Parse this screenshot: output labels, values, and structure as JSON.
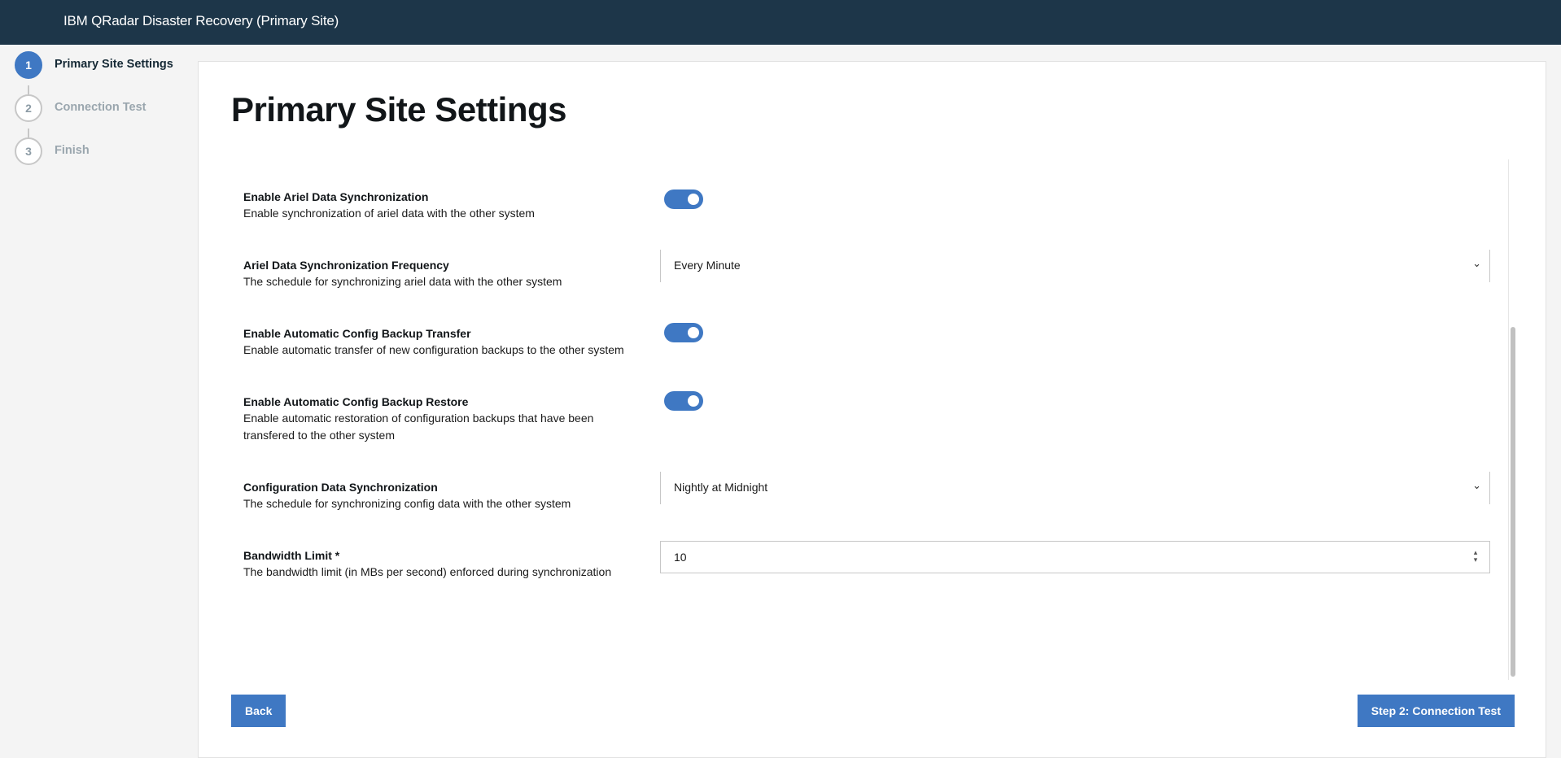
{
  "app": {
    "title": "IBM QRadar Disaster Recovery (Primary Site)"
  },
  "stepper": {
    "steps": [
      {
        "number": "1",
        "label": "Primary Site Settings",
        "active": true
      },
      {
        "number": "2",
        "label": "Connection Test",
        "active": false
      },
      {
        "number": "3",
        "label": "Finish",
        "active": false
      }
    ]
  },
  "page": {
    "title": "Primary Site Settings"
  },
  "settings": [
    {
      "label": "Enable Ariel Data Synchronization",
      "description": "Enable synchronization of ariel data with the other system",
      "control": "toggle",
      "value": "on"
    },
    {
      "label": "Ariel Data Synchronization Frequency",
      "description": "The schedule for synchronizing ariel data with the other system",
      "control": "select",
      "value": "Every Minute"
    },
    {
      "label": "Enable Automatic Config Backup Transfer",
      "description": "Enable automatic transfer of new configuration backups to the other system",
      "control": "toggle",
      "value": "on"
    },
    {
      "label": "Enable Automatic Config Backup Restore",
      "description": "Enable automatic restoration of configuration backups that have been transfered to the other system",
      "control": "toggle",
      "value": "on"
    },
    {
      "label": "Configuration Data Synchronization",
      "description": "The schedule for synchronizing config data with the other system",
      "control": "select",
      "value": "Nightly at Midnight"
    },
    {
      "label": "Bandwidth Limit *",
      "description": "The bandwidth limit (in MBs per second) enforced during synchronization",
      "control": "number",
      "value": "10"
    }
  ],
  "actions": {
    "back_label": "Back",
    "next_label": "Step 2: Connection Test"
  },
  "colors": {
    "accent": "#3f78c3",
    "header": "#1d3649"
  },
  "icons": {
    "select_chevron": "chevron-down-icon",
    "spinner": "up-down-spinner-icon"
  }
}
